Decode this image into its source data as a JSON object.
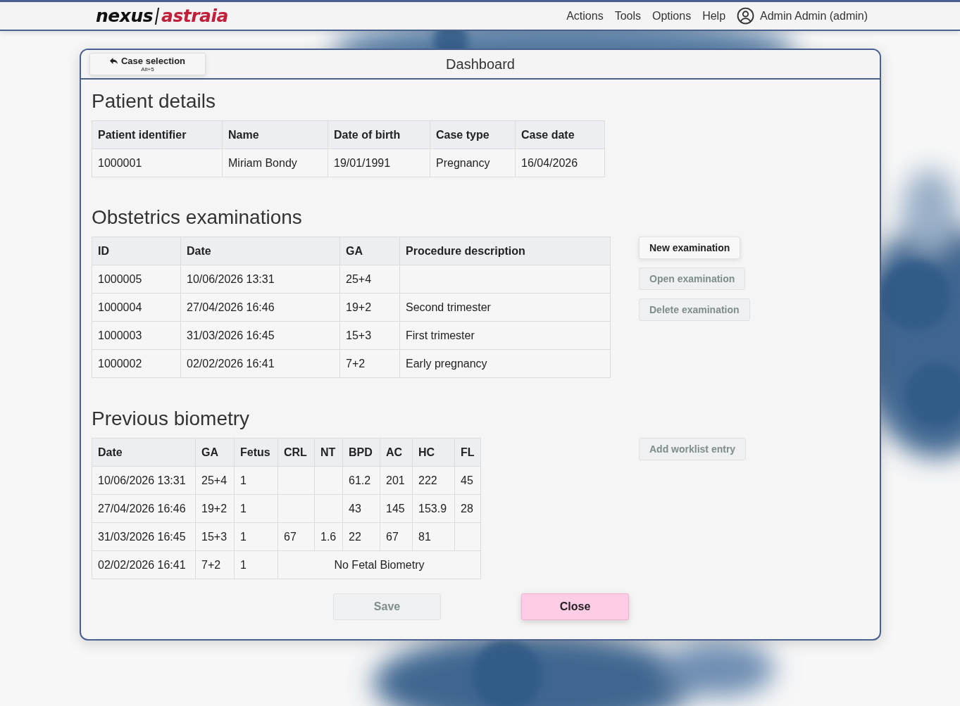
{
  "header": {
    "logo_left": "nexus",
    "logo_right": "astraia",
    "menu": [
      "Actions",
      "Tools",
      "Options",
      "Help"
    ],
    "user": "Admin Admin (admin)"
  },
  "dialog": {
    "title": "Dashboard",
    "back_button": {
      "label": "Case selection",
      "shortcut": "Alt+5"
    }
  },
  "sections": [
    {
      "title": "Patient details",
      "columns": [
        "Patient identifier",
        "Name",
        "Date of birth",
        "Case type",
        "Case date"
      ],
      "rows": [
        {
          "cells": [
            "1000001",
            "Miriam Bondy",
            "19/01/1991",
            "Pregnancy",
            "16/04/2026"
          ]
        }
      ]
    },
    {
      "title": "Obstetrics examinations",
      "columns": [
        "ID",
        "Date",
        "GA",
        "Procedure description"
      ],
      "rows": [
        {
          "cells": [
            "1000005",
            "10/06/2026 13:31",
            "25+4",
            null
          ]
        },
        {
          "cells": [
            "1000004",
            "27/04/2026 16:46",
            "19+2",
            "Second trimester"
          ]
        },
        {
          "cells": [
            "1000003",
            "31/03/2026 16:45",
            "15+3",
            "First trimester"
          ]
        },
        {
          "cells": [
            "1000002",
            "02/02/2026 16:41",
            "7+2",
            "Early pregnancy"
          ]
        }
      ],
      "buttons": [
        {
          "label": "New examination",
          "disabled": false
        },
        {
          "label": "Open examination",
          "disabled": true
        },
        {
          "label": "Delete examination",
          "disabled": true
        }
      ]
    },
    {
      "title": "Previous biometry",
      "columns": [
        "Date",
        "GA",
        "Fetus",
        "CRL",
        "NT",
        "BPD",
        "AC",
        "HC",
        "FL"
      ],
      "rows": [
        {
          "cells": [
            "10/06/2026 13:31",
            "25+4",
            "1",
            null,
            null,
            "61.2",
            "201",
            "222",
            "45"
          ]
        },
        {
          "cells": [
            "27/04/2026 16:46",
            "19+2",
            "1",
            null,
            null,
            "43",
            "145",
            "153.9",
            "28"
          ]
        },
        {
          "cells": [
            "31/03/2026 16:45",
            "15+3",
            "1",
            "67",
            "1.6",
            "22",
            "67",
            "81",
            null
          ]
        },
        {
          "cells": [
            "02/02/2026 16:41",
            "7+2",
            "1"
          ],
          "note": "No Fetal Biometry"
        }
      ],
      "buttons": [
        {
          "label": "Add worklist entry",
          "disabled": true
        }
      ]
    }
  ],
  "footer_buttons": [
    {
      "label": "Save",
      "kind": "secondary",
      "disabled": true
    },
    {
      "label": "Close",
      "kind": "primary",
      "disabled": false
    }
  ]
}
